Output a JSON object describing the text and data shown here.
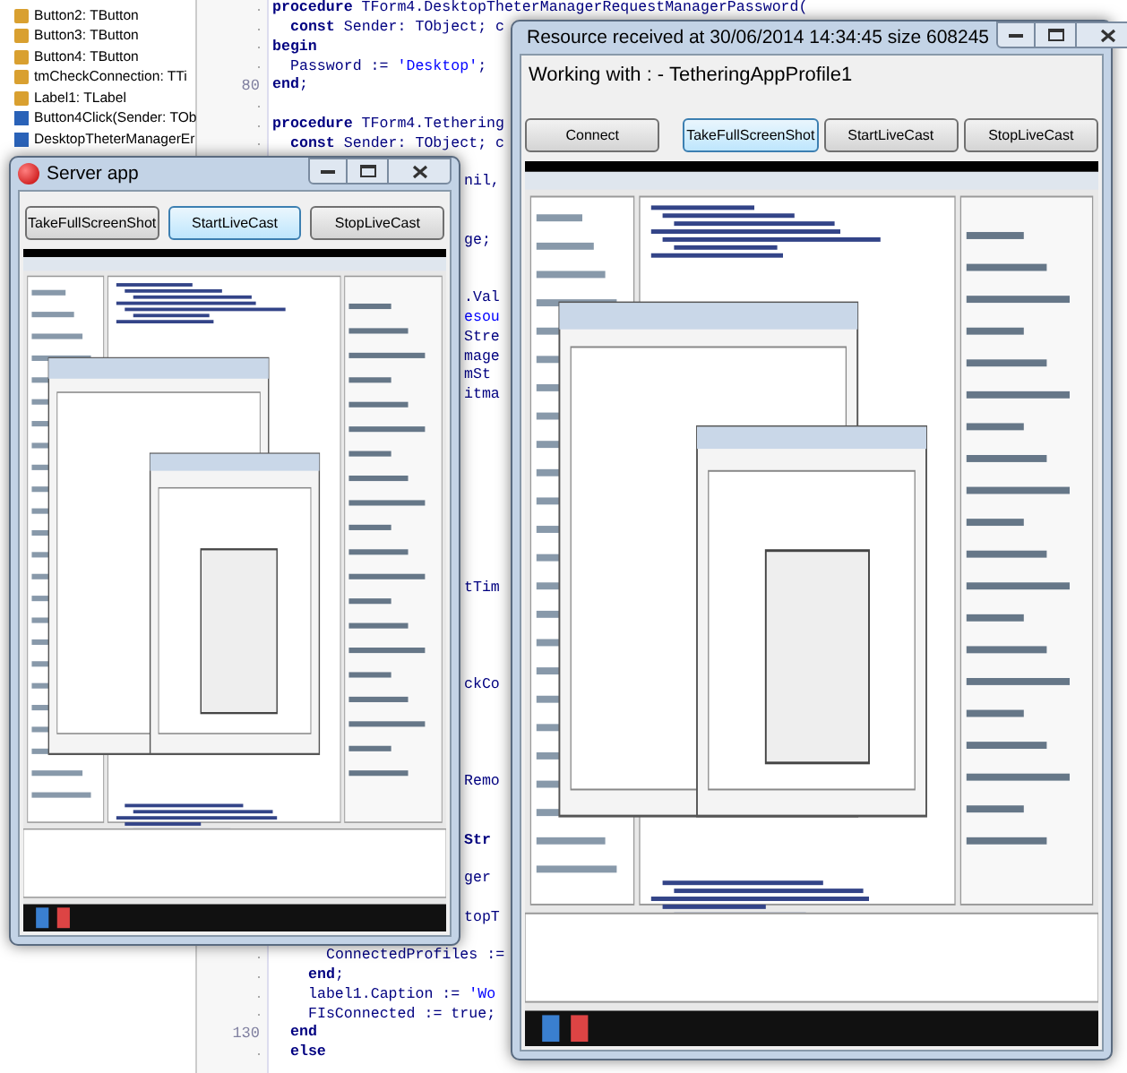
{
  "structure_tree": {
    "items": [
      {
        "label": "Button2: TButton",
        "kind": "component"
      },
      {
        "label": "Button3: TButton",
        "kind": "component"
      },
      {
        "label": "Button4: TButton",
        "kind": "component"
      },
      {
        "label": "tmCheckConnection: TTi",
        "kind": "component"
      },
      {
        "label": "Label1: TLabel",
        "kind": "component"
      },
      {
        "label": "Button4Click(Sender: TOb",
        "kind": "method"
      },
      {
        "label": "DesktopTheterManagerEr",
        "kind": "method"
      }
    ]
  },
  "editor": {
    "lines": [
      {
        "kind": "indent0",
        "segments": [
          {
            "kind": "keyword",
            "text": "procedure"
          },
          {
            "kind": "plain",
            "text": " TForm4.DesktopTheterManagerRequestManagerPassword("
          }
        ]
      },
      {
        "kind": "indent1",
        "segments": [
          {
            "kind": "keyword",
            "text": "const"
          },
          {
            "kind": "plain",
            "text": " Sender: TObject; c"
          }
        ]
      },
      {
        "kind": "indent0",
        "segments": [
          {
            "kind": "keyword",
            "text": "begin"
          }
        ]
      },
      {
        "kind": "indent1",
        "segments": [
          {
            "kind": "plain",
            "text": "Password := "
          },
          {
            "kind": "string",
            "text": "'Desktop'"
          },
          {
            "kind": "plain",
            "text": ";"
          }
        ]
      },
      {
        "kind": "indent0",
        "number": "80",
        "segments": [
          {
            "kind": "keyword",
            "text": "end"
          },
          {
            "kind": "plain",
            "text": ";"
          }
        ]
      },
      {
        "kind": "blank"
      },
      {
        "kind": "indent0",
        "segments": [
          {
            "kind": "keyword",
            "text": "procedure"
          },
          {
            "kind": "plain",
            "text": " TForm4.Tethering"
          }
        ]
      },
      {
        "kind": "indent1",
        "segments": [
          {
            "kind": "keyword",
            "text": "const"
          },
          {
            "kind": "plain",
            "text": " Sender: TObject; c"
          }
        ]
      },
      {
        "kind": "blank"
      },
      {
        "kind": "fragment",
        "segments": [
          {
            "kind": "plain",
            "text": "nil,"
          }
        ]
      },
      {
        "kind": "blank"
      },
      {
        "kind": "blank"
      },
      {
        "kind": "fragment",
        "segments": [
          {
            "kind": "plain",
            "text": "ge;"
          }
        ]
      },
      {
        "kind": "blank"
      },
      {
        "kind": "blank"
      },
      {
        "kind": "fragment",
        "segments": [
          {
            "kind": "plain",
            "text": ".Val"
          }
        ]
      },
      {
        "kind": "fragment",
        "segments": [
          {
            "kind": "string",
            "text": "esou"
          }
        ]
      },
      {
        "kind": "fragment",
        "segments": [
          {
            "kind": "plain",
            "text": "Stre"
          }
        ]
      },
      {
        "kind": "fragment",
        "segments": [
          {
            "kind": "plain",
            "text": "mage"
          }
        ]
      },
      {
        "kind": "fragment",
        "segments": [
          {
            "kind": "plain",
            "text": "mSt"
          }
        ]
      },
      {
        "kind": "fragment",
        "segments": [
          {
            "kind": "plain",
            "text": "itma"
          }
        ]
      },
      {
        "kind": "blank"
      },
      {
        "kind": "blank"
      },
      {
        "kind": "blank"
      },
      {
        "kind": "blank"
      },
      {
        "kind": "blank"
      },
      {
        "kind": "blank"
      },
      {
        "kind": "blank"
      },
      {
        "kind": "blank"
      },
      {
        "kind": "blank"
      },
      {
        "kind": "fragment",
        "segments": [
          {
            "kind": "plain",
            "text": "tTim"
          }
        ]
      },
      {
        "kind": "blank"
      },
      {
        "kind": "blank"
      },
      {
        "kind": "blank"
      },
      {
        "kind": "blank"
      },
      {
        "kind": "fragment",
        "segments": [
          {
            "kind": "plain",
            "text": "ckCo"
          }
        ]
      },
      {
        "kind": "blank"
      },
      {
        "kind": "blank"
      },
      {
        "kind": "blank"
      },
      {
        "kind": "blank"
      },
      {
        "kind": "fragment",
        "segments": [
          {
            "kind": "plain",
            "text": "Remo"
          }
        ]
      },
      {
        "kind": "blank"
      },
      {
        "kind": "blank"
      },
      {
        "kind": "fragment",
        "segments": [
          {
            "kind": "keyword",
            "text": "Str"
          }
        ]
      },
      {
        "kind": "blank"
      },
      {
        "kind": "fragment",
        "segments": [
          {
            "kind": "plain",
            "text": "ger"
          }
        ]
      },
      {
        "kind": "blank"
      },
      {
        "kind": "fragment",
        "segments": [
          {
            "kind": "plain",
            "text": "topT"
          }
        ]
      },
      {
        "kind": "blank"
      },
      {
        "kind": "indent3",
        "segments": [
          {
            "kind": "plain",
            "text": "ConnectedProfiles :="
          }
        ]
      },
      {
        "kind": "indent2",
        "segments": [
          {
            "kind": "keyword",
            "text": "end"
          },
          {
            "kind": "plain",
            "text": ";"
          }
        ]
      },
      {
        "kind": "indent2",
        "segments": [
          {
            "kind": "plain",
            "text": "label1.Caption := "
          },
          {
            "kind": "string",
            "text": "'Wo"
          }
        ]
      },
      {
        "kind": "indent2",
        "segments": [
          {
            "kind": "plain",
            "text": "FIsConnected := true;"
          }
        ]
      },
      {
        "kind": "indent1",
        "number": "130",
        "segments": [
          {
            "kind": "keyword",
            "text": "end"
          }
        ]
      },
      {
        "kind": "indent1",
        "segments": [
          {
            "kind": "keyword",
            "text": "else"
          }
        ]
      }
    ]
  },
  "windows": [
    {
      "kind": "server",
      "title": "Server app",
      "buttons": [
        {
          "label": "TakeFullScreenShot",
          "selected": false
        },
        {
          "label": "StartLiveCast",
          "selected": true
        },
        {
          "label": "StopLiveCast",
          "selected": false
        }
      ]
    },
    {
      "kind": "resource",
      "title": "Resource received at 30/06/2014 14:34:45 size 608245",
      "status": "Working with : - TetheringAppProfile1",
      "buttons": [
        {
          "label": "Connect",
          "selected": false
        },
        {
          "label": "TakeFullScreenShot",
          "selected": true
        },
        {
          "label": "StartLiveCast",
          "selected": false
        },
        {
          "label": "StopLiveCast",
          "selected": false
        }
      ]
    }
  ]
}
